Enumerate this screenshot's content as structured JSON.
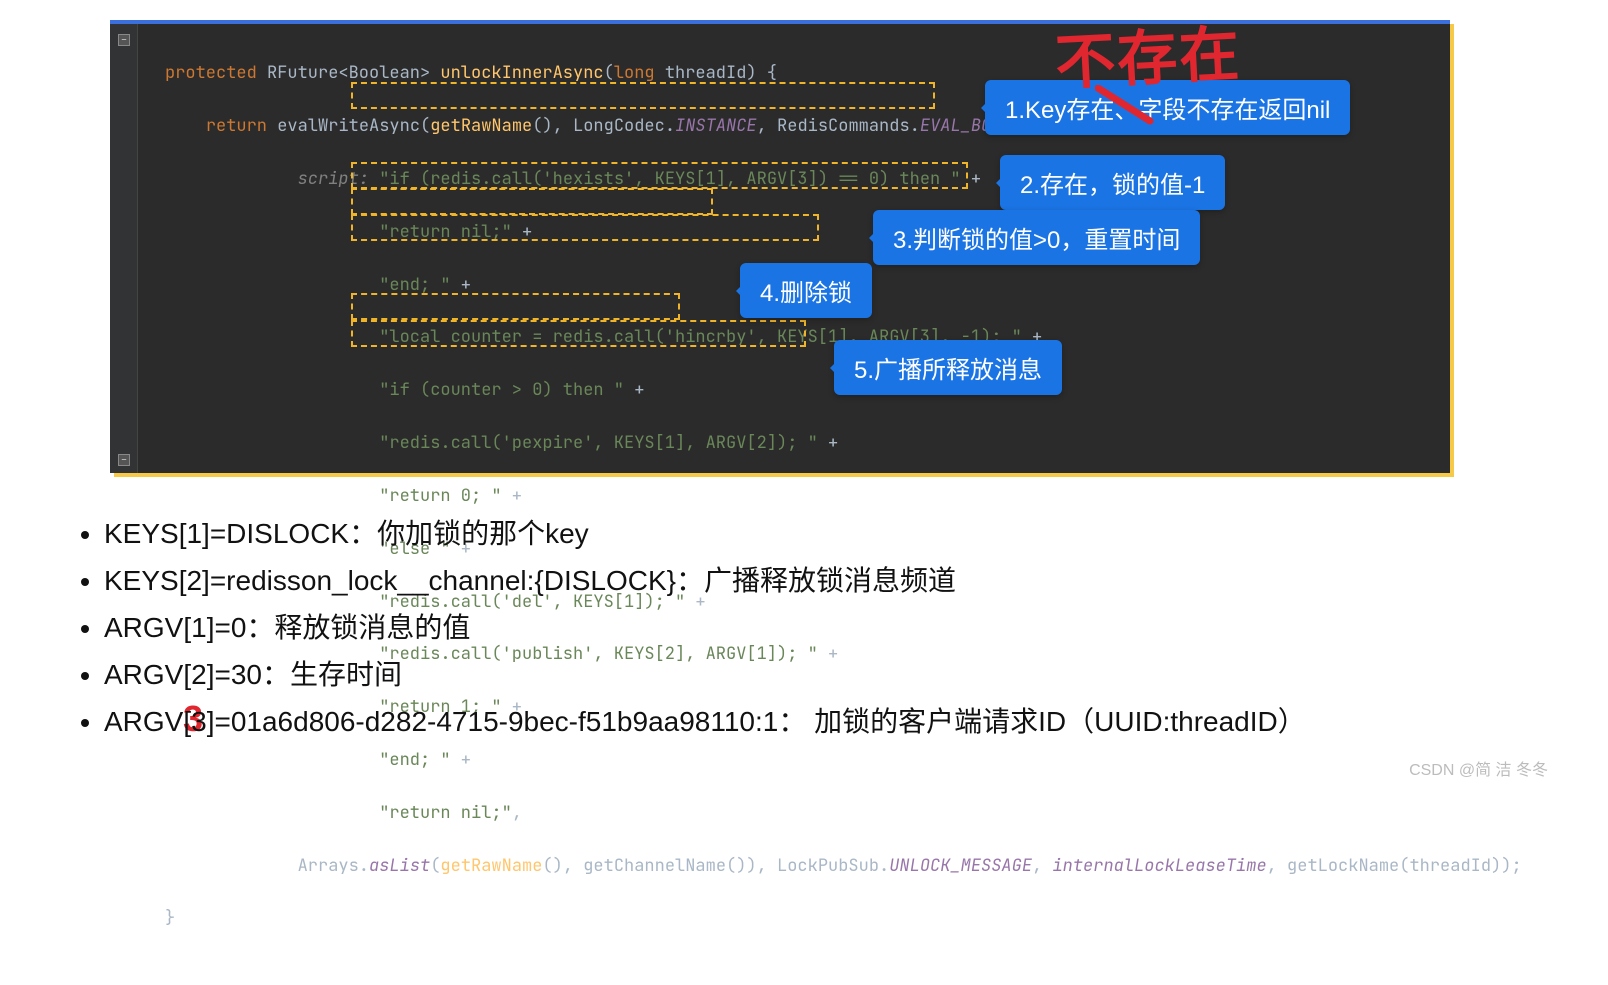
{
  "callouts": {
    "c1": "1.Key存在、字段不存在返回nil",
    "c2": "2.存在，锁的值-1",
    "c3": "3.判断锁的值>0，重置时间",
    "c4": "4.删除锁",
    "c5": "5.广播所释放消息"
  },
  "red_label": "不存在",
  "red_mark": "3",
  "code": {
    "l1_a": "protected ",
    "l1_b": "RFuture<Boolean> ",
    "l1_c": "unlockInnerAsync",
    "l1_d": "(",
    "l1_e": "long ",
    "l1_f": "threadId) {",
    "l2_a": "return ",
    "l2_b": "evalWriteAsync(",
    "l2_c": "getRawName",
    "l2_d": "(), LongCodec.",
    "l2_e": "INSTANCE",
    "l2_f": ", RedisCommands.",
    "l2_g": "EVAL_BOOLEAN",
    "l2_h": ",",
    "l3_a": "script: ",
    "l3_b": "\"if (redis.call('hexists', KEYS[1], ARGV[3]) == 0) then \"",
    "l3_c": " + ",
    "l4_b": "\"return nil;\"",
    "l4_c": " + ",
    "l5_b": "\"end; \"",
    "l5_c": " + ",
    "l6_b": "\"local counter = redis.call('hincrby', KEYS[1], ARGV[3], -1); \"",
    "l6_c": " + ",
    "l7_b": "\"if (counter > 0) then \"",
    "l7_c": " + ",
    "l8_b": "\"redis.call('pexpire', KEYS[1], ARGV[2]); \"",
    "l8_c": " + ",
    "l9_b": "\"return 0; \"",
    "l9_c": " + ",
    "l10_b": "\"else \"",
    "l10_c": " + ",
    "l11_b": "\"redis.call('del', KEYS[1]); \"",
    "l11_c": " + ",
    "l12_b": "\"redis.call('publish', KEYS[2], ARGV[1]); \"",
    "l12_c": " + ",
    "l13_b": "\"return 1; \"",
    "l13_c": " + ",
    "l14_b": "\"end; \"",
    "l14_c": " + ",
    "l15_b": "\"return nil;\"",
    "l15_c": ",",
    "l16_a": "Arrays.",
    "l16_b": "asList",
    "l16_c": "(",
    "l16_d": "getRawName",
    "l16_e": "(), getChannelName()), LockPubSub.",
    "l16_f": "UNLOCK_MESSAGE",
    "l16_g": ", ",
    "l16_h": "internalLockLeaseTime",
    "l16_i": ", getLockName(threadId));",
    "l17": "}"
  },
  "bullets": {
    "b1": "KEYS[1]=DISLOCK：你加锁的那个key",
    "b2": "KEYS[2]=redisson_lock__channel:{DISLOCK}：广播释放锁消息频道",
    "b3": "ARGV[1]=0：释放锁消息的值",
    "b4": "ARGV[2]=30：生存时间",
    "b5": "ARGV[3]=01a6d806-d282-4715-9bec-f51b9aa98110:1： 加锁的客户端请求ID（UUID:threadID）"
  },
  "watermark": "CSDN @简 洁 冬冬"
}
